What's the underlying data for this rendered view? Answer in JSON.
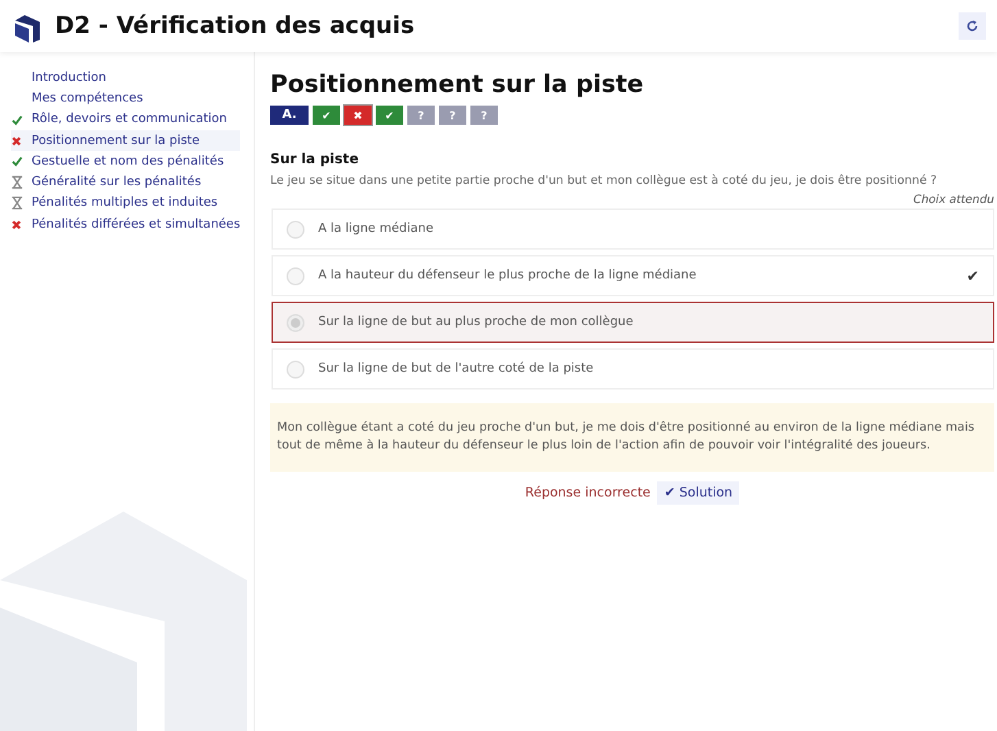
{
  "header": {
    "title": "D2 - Vérification des acquis"
  },
  "sidebar": {
    "items": [
      {
        "label": "Introduction",
        "kind": "plain",
        "selected": false
      },
      {
        "label": "Mes compétences",
        "kind": "plain",
        "selected": false
      },
      {
        "label": "Rôle, devoirs et communication",
        "kind": "done",
        "selected": false
      },
      {
        "label": "Positionnement sur la piste",
        "kind": "failed",
        "selected": true
      },
      {
        "label": "Gestuelle et nom des pénalités",
        "kind": "done",
        "selected": false
      },
      {
        "label": "Généralité sur les pénalités",
        "kind": "pending",
        "selected": false
      },
      {
        "label": "Pénalités multiples et induites",
        "kind": "pending",
        "selected": false
      },
      {
        "label": "Pénalités différées et simultanées",
        "kind": "failed",
        "selected": false
      }
    ]
  },
  "page": {
    "title": "Positionnement sur la piste",
    "progress": [
      {
        "text": "A.",
        "kind": "intro",
        "selected": false
      },
      {
        "text": "✔",
        "kind": "correct",
        "selected": false
      },
      {
        "text": "✖",
        "kind": "wrong",
        "selected": true
      },
      {
        "text": "✔",
        "kind": "correct",
        "selected": false
      },
      {
        "text": "?",
        "kind": "unanswered",
        "selected": false
      },
      {
        "text": "?",
        "kind": "unanswered",
        "selected": false
      },
      {
        "text": "?",
        "kind": "unanswered",
        "selected": false
      }
    ],
    "question_title": "Sur la piste",
    "question": "Le jeu se situe dans une petite partie proche d'un but et mon collègue est à coté du jeu, je dois être positionné ?",
    "expected_header": "Choix attendu",
    "options": [
      {
        "label": "A la ligne médiane",
        "selected": false
      },
      {
        "label": "A la hauteur du défenseur le plus proche de la ligne médiane",
        "selected": false,
        "mark": "✔"
      },
      {
        "label": "Sur la ligne de but au plus proche de mon collègue",
        "selected": true
      },
      {
        "label": "Sur la ligne de but de l'autre coté de la piste",
        "selected": false
      }
    ],
    "explanation": "Mon collègue étant a coté du jeu proche d'un but, je me dois d'être positionné au environ de la ligne médiane mais tout de même à la hauteur du défenseur le plus loin de l'action afin de pouvoir voir l'intégralité des joueurs.",
    "result": "Réponse incorrecte",
    "solution_button": "✔ Solution"
  }
}
